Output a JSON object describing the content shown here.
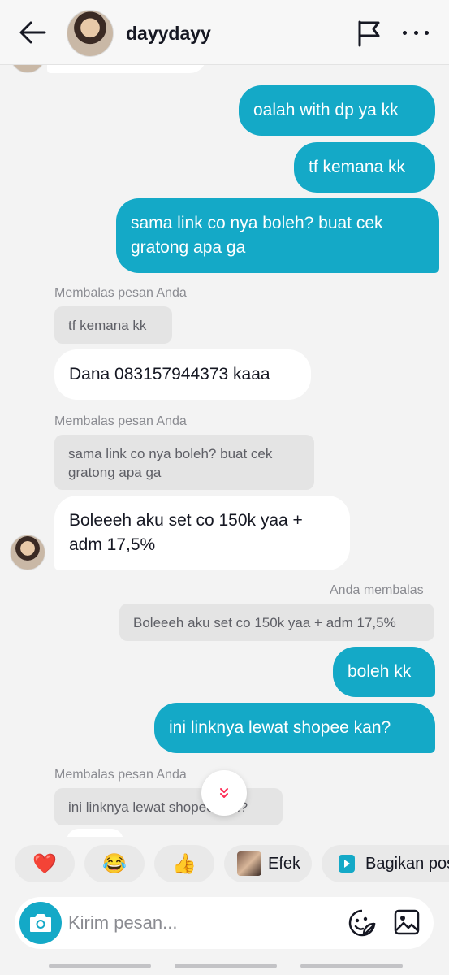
{
  "header": {
    "username": "dayydayy"
  },
  "messages": {
    "out1": "oalah with dp ya kk",
    "out2": "tf kemana kk",
    "out3_line1": "sama link co nya boleh? buat cek",
    "out3_line2": "gratong apa ga",
    "reply_label_1": "Membalas pesan Anda",
    "quote_1": "tf kemana kk",
    "in1": "Dana 083157944373 kaaa",
    "reply_label_2": "Membalas pesan Anda",
    "quote_2_line1": "sama link co nya boleh? buat cek",
    "quote_2_line2": "gratong apa ga",
    "in2_line1": "Boleeeh aku set co 150k yaa +",
    "in2_line2": "adm 17,5%",
    "reply_label_3": "Anda membalas",
    "quote_3": "Boleeeh aku set co 150k yaa + adm 17,5%",
    "out4": "boleh kk",
    "out5": "ini linknya lewat shopee kan?",
    "reply_label_4": "Membalas pesan Anda",
    "quote_4": "ini linknya lewat shopee kan?"
  },
  "reactions": {
    "heart": "❤️",
    "laugh": "😂",
    "thumbs": "👍",
    "effect_label": "Efek",
    "share_label": "Bagikan pos"
  },
  "composer": {
    "placeholder": "Kirim pesan..."
  },
  "colors": {
    "accent": "#14a9c7",
    "background": "#f3f3f3",
    "incoming_bubble": "#ffffff",
    "quote_bubble": "#e4e4e4"
  },
  "icons": [
    "back-arrow-icon",
    "flag-icon",
    "more-icon",
    "chevron-double-down-icon",
    "camera-icon",
    "sticker-icon",
    "image-icon",
    "play-share-icon"
  ]
}
